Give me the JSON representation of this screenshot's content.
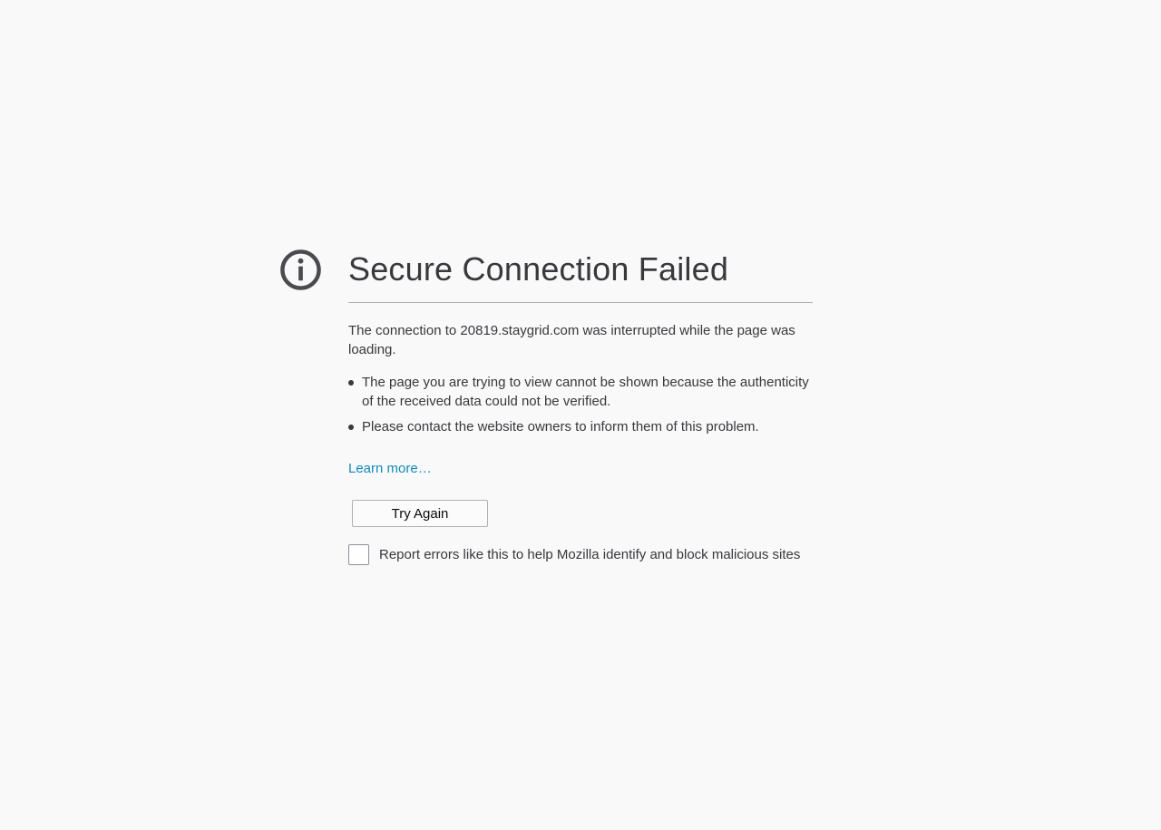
{
  "page": {
    "icon": "info-icon",
    "title": "Secure Connection Failed",
    "description": "The connection to 20819.staygrid.com was interrupted while the page was loading.",
    "reasons": [
      "The page you are trying to view cannot be shown because the authenticity of the received data could not be verified.",
      "Please contact the website owners to inform them of this problem."
    ],
    "learn_more": "Learn more…",
    "try_again": "Try Again",
    "report_label": "Report errors like this to help Mozilla identify and block malicious sites",
    "report_checked": false
  },
  "colors": {
    "background": "#f9f9fa",
    "text": "#38383d",
    "link": "#0a8dc6",
    "icon": "#4a4a4f"
  }
}
